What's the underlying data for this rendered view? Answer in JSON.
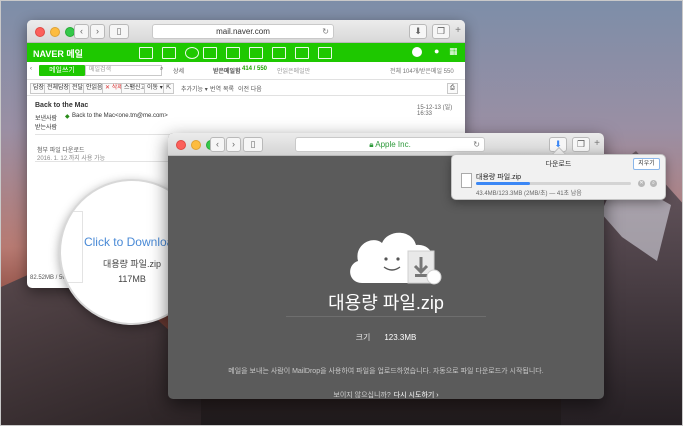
{
  "colors": {
    "naver_green": "#1ec800",
    "accent_blue": "#3b87f5",
    "maildrop_bg": "#5b5b5b"
  },
  "mail_window": {
    "url": "mail.naver.com",
    "brand": "NAVER 메일",
    "write_button": "메일쓰기",
    "search_placeholder": "메일검색",
    "search_option": "상세",
    "inbox_label": "받은메일함",
    "inbox_count": "414 / 550",
    "inbox_sub": "안읽은메일만",
    "right_note": "전체 104개/받은메일 550",
    "actions": [
      "답장",
      "전체답장",
      "전달",
      "안읽음",
      "✕ 삭제",
      "스팸신고",
      "이동 ▾",
      "추가기능 ▾",
      "번역",
      "목록",
      "이전 다음"
    ],
    "subject": "Back to the Mac",
    "date": "15-12-13 (일) 16:33",
    "from_label": "보낸사람",
    "from_value": "Back to the Mac<one.tm@me.com>",
    "to_label": "받는사람",
    "attach_label": "첨부 파일 다운로드",
    "attach_note": "2016. 1. 12.까지 사용 가능",
    "footer": "82.52MB / 5GB"
  },
  "magnifier": {
    "link": "Click to Download",
    "file_name": "대용량 파일.zip",
    "file_size": "117MB"
  },
  "maildrop_window": {
    "url": "Apple Inc.",
    "file_name": "대용량 파일.zip",
    "size_label": "크기",
    "size_value": "123.3MB",
    "description": "메일을 보내는 사람이 MailDrop을 사용하여 파일을 업로드하였습니다. 자동으로 파일 다운로드가 시작됩니다.",
    "retry_prompt": "보이지 않으십니까?",
    "retry_link": "다시 시도하기 ›"
  },
  "downloads": {
    "title": "다운로드",
    "clear_button": "지우기",
    "file_name": "대용량 파일.zip",
    "status": "43.4MB/123.3MB (2MB/초) — 41초 남음",
    "progress": 0.35
  }
}
